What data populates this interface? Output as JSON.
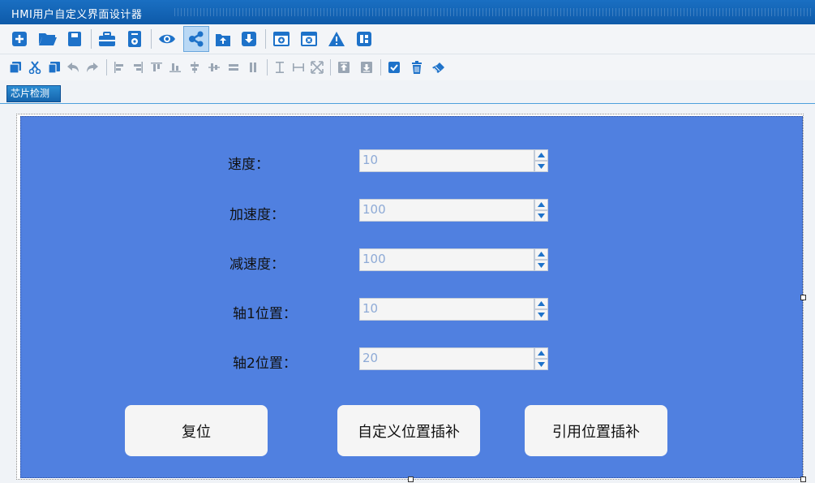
{
  "window": {
    "title": "HMI用户自定义界面设计器"
  },
  "toolbar1": [
    "new-file-icon",
    "open-folder-icon",
    "save-icon",
    "toolbox-icon",
    "settings-doc-icon",
    "eye-icon",
    "share-icon",
    "upload-icon",
    "download-icon",
    "add-window-icon",
    "close-window-icon",
    "warning-icon",
    "layout-icon"
  ],
  "toolbar2": [
    "copy-icon",
    "cut-icon",
    "paste-icon",
    "undo-icon",
    "redo-icon",
    "align-left-icon",
    "align-right-icon",
    "align-top-icon",
    "align-bottom-icon",
    "align-center-v-icon",
    "align-center-h-icon",
    "distribute-v-icon",
    "distribute-h-icon",
    "same-height-icon",
    "same-width-icon",
    "same-size-icon",
    "bring-front-icon",
    "send-back-icon",
    "check-icon",
    "delete-icon",
    "brush-icon"
  ],
  "tab": {
    "label": "芯片检测"
  },
  "form": {
    "fields": [
      {
        "label": "速度：",
        "value": "10"
      },
      {
        "label": "加速度：",
        "value": "100"
      },
      {
        "label": "减速度：",
        "value": "100"
      },
      {
        "label": "轴1位置：",
        "value": "10"
      },
      {
        "label": "轴2位置：",
        "value": "20"
      }
    ],
    "buttons": [
      {
        "label": "复位"
      },
      {
        "label": "自定义位置插补"
      },
      {
        "label": "引用位置插补"
      }
    ]
  },
  "colors": {
    "titlebar": "#0e5aa9",
    "design_surface": "#5080e0",
    "icon_blue": "#1e72c9",
    "button_bg": "#f5f5f5"
  }
}
